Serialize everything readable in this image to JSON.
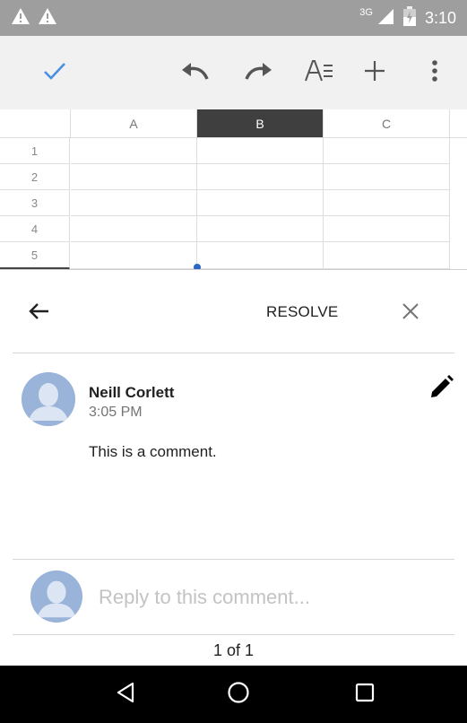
{
  "status_bar": {
    "time": "3:10",
    "network": "3G"
  },
  "sheet": {
    "columns": [
      "A",
      "B",
      "C"
    ],
    "selected_column": "B",
    "rows": [
      "1",
      "2",
      "3",
      "4",
      "5"
    ]
  },
  "comment_panel": {
    "resolve_label": "RESOLVE",
    "comment": {
      "author": "Neill Corlett",
      "time": "3:05 PM",
      "text": "This is a comment."
    },
    "reply_placeholder": "Reply to this comment...",
    "pager": "1 of 1"
  },
  "colors": {
    "status_bar": "#9e9e9e",
    "toolbar": "#f1f1f1",
    "accent": "#4a90e2",
    "selected_header": "#3f3f3f"
  }
}
